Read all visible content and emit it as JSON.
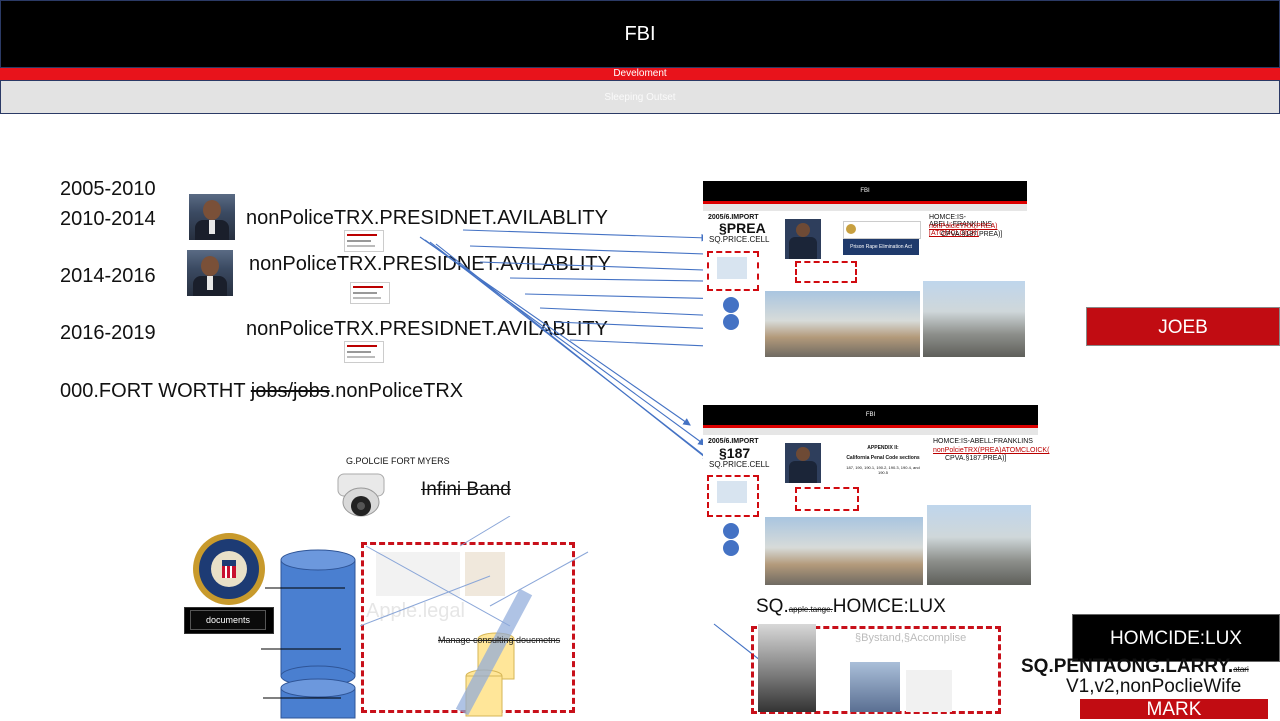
{
  "header": {
    "title": "FBI",
    "development_label": "Develoment",
    "subtitle": "Sleeping Outset"
  },
  "timeline": {
    "years": [
      "2005-2010",
      "2010-2014",
      "2014-2016",
      "2016-2019"
    ],
    "entries": [
      "nonPoliceTRX.PRESIDNET.AVILABLITY",
      "nonPoliceTRX.PRESIDNET.AVILABLITY",
      "nonPoliceTRX.PRESIDNET.AVILABLITY"
    ],
    "fort_worth_prefix": "000.FORT WORTHT ",
    "fort_worth_struck": "jobs/jobs",
    "fort_worth_suffix": ".nonPoliceTRX"
  },
  "slide_top": {
    "bar_title": "FBI",
    "code_prefix": "2005/6.IMPORT",
    "code_main": "§PREA",
    "sub": "SQ.PRICE.CELL",
    "right_title": "HOMCE:IS-ABELL:FRANKLINS",
    "right_link": "nonPolcieTRX(PREA)[ATOMCLOICK(",
    "right_link2": "CPVA.§187.PREA)]",
    "banner": "Prison Rape Elimination Act"
  },
  "slide_bottom": {
    "bar_title": "FBI",
    "code_prefix": "2005/6.IMPORT",
    "code_main": "§187",
    "sub": "SQ.PRICE.CELL",
    "appendix_title": "APPENDIX II:",
    "appendix_sub": "California Penal Code sections",
    "appendix_nums": "187, 190, 190.1, 190.2, 190.3, 190.4, and 190.5",
    "right_title": "HOMCE:IS-ABELL:FRANKLINS",
    "right_link": "nonPolcieTRX(PREA)ATOMCLOICK(",
    "right_link2": "CPVA.§187.PREA)]"
  },
  "camera_label": "G.POLCIE FORT MYERS",
  "infini_band": "Infini Band",
  "documents_label": "documents",
  "faded_apple": "Apple.legal",
  "manage_text": "Manage consulting doucmetns",
  "sq_prefix": "SQ.",
  "sq_small": "apple.tange.",
  "sq_suffix": "HOMCE:LUX",
  "bystand": "§Bystand,§Accomplise",
  "buttons": {
    "joeb": "JOEB",
    "homcide": "HOMCIDE:LUX",
    "mark": "MARK"
  },
  "pentagon_main": "SQ.PENTAONG.LARRY.",
  "pentagon_small": "atari",
  "v_line": "V1,v2,nonPoclieWife",
  "colors": {
    "accent_red": "#e8131b",
    "header_black": "#000000",
    "arrow_blue": "#4472c4",
    "cylinder_blue": "#4a7fd0"
  }
}
